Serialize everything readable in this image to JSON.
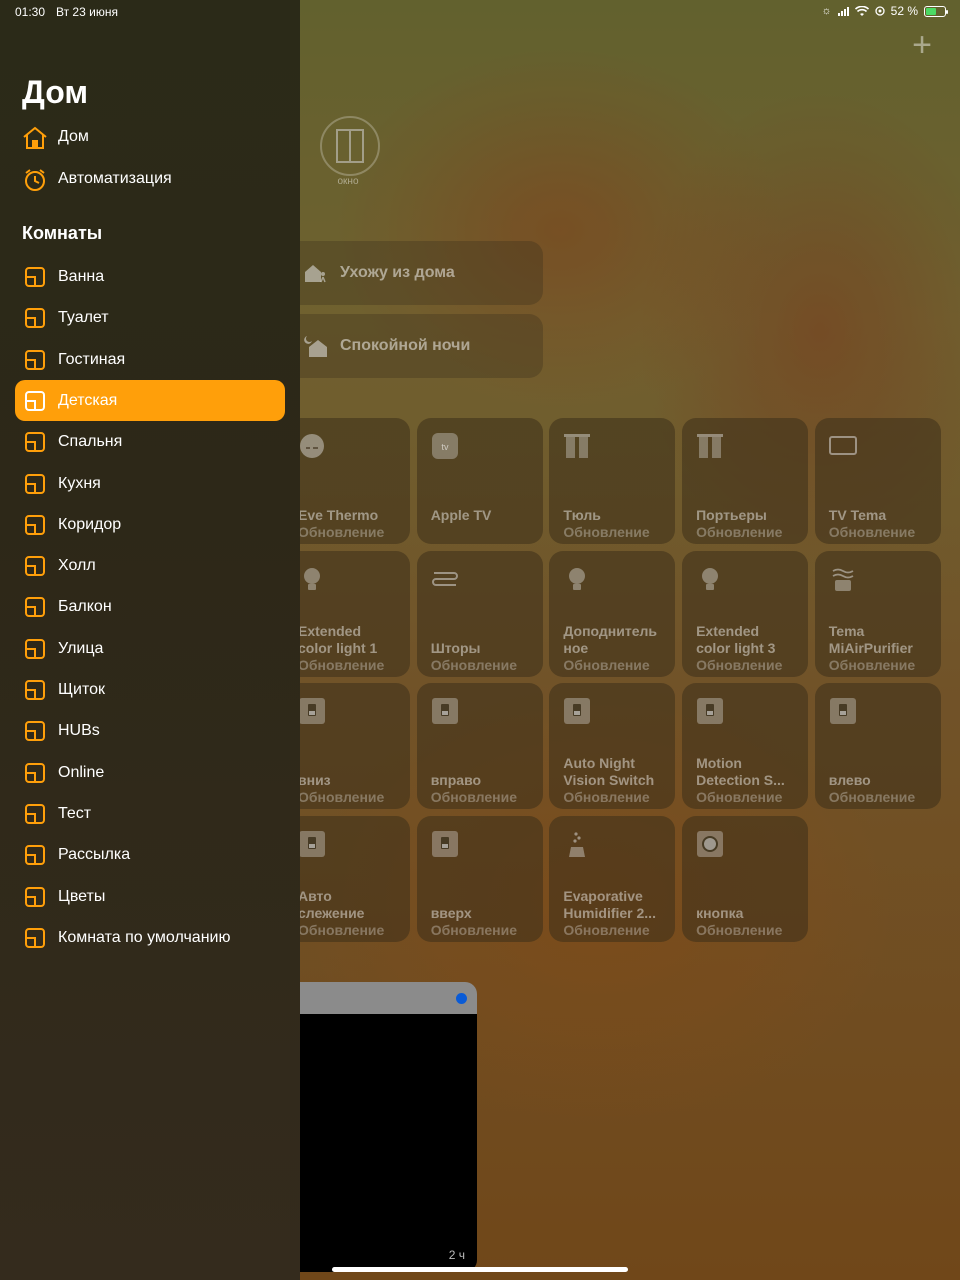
{
  "status_bar": {
    "time": "01:30",
    "date": "Вт 23 июня",
    "battery": "52 %"
  },
  "sidebar": {
    "title": "Дом",
    "nav": [
      {
        "label": "Дом",
        "icon": "house-icon"
      },
      {
        "label": "Автоматизация",
        "icon": "clock-icon"
      }
    ],
    "rooms_header": "Комнаты",
    "rooms": [
      {
        "label": "Ванна",
        "active": false
      },
      {
        "label": "Туалет",
        "active": false
      },
      {
        "label": "Гостиная",
        "active": false
      },
      {
        "label": "Детская",
        "active": true
      },
      {
        "label": "Спальня",
        "active": false
      },
      {
        "label": "Кухня",
        "active": false
      },
      {
        "label": "Коридор",
        "active": false
      },
      {
        "label": "Холл",
        "active": false
      },
      {
        "label": "Балкон",
        "active": false
      },
      {
        "label": "Улица",
        "active": false
      },
      {
        "label": "Щиток",
        "active": false
      },
      {
        "label": "HUBs",
        "active": false
      },
      {
        "label": "Online",
        "active": false
      },
      {
        "label": "Тест",
        "active": false
      },
      {
        "label": "Рассылка",
        "active": false
      },
      {
        "label": "Цветы",
        "active": false
      },
      {
        "label": "Комната по умолчанию",
        "active": false
      }
    ],
    "accent_color": "#ff9f0a"
  },
  "main": {
    "window_accessory": "окно",
    "scenes": [
      {
        "label": "Ухожу из дома",
        "icon": "leave-home-icon"
      },
      {
        "label": "Спокойной ночи",
        "icon": "goodnight-home-icon"
      }
    ],
    "tiles": [
      {
        "name": "Eve Thermo",
        "status": "Обновление",
        "icon": "thermostat-icon"
      },
      {
        "name": "Apple TV",
        "status": "",
        "icon": "apple-tv-icon"
      },
      {
        "name": "Тюль",
        "status": "Обновление",
        "icon": "curtain-icon"
      },
      {
        "name": "Портьеры",
        "status": "Обновление",
        "icon": "curtain-icon"
      },
      {
        "name": "TV Tema",
        "status": "Обновление",
        "icon": "tv-icon"
      },
      {
        "name": "Extended\ncolor light 1",
        "status": "Обновление",
        "icon": "bulb-icon"
      },
      {
        "name": "Шторы",
        "status": "Обновление",
        "icon": "blinds-icon"
      },
      {
        "name": "Доподнитель\nное",
        "status": "Обновление",
        "icon": "bulb-icon"
      },
      {
        "name": "Extended\ncolor light 3",
        "status": "Обновление",
        "icon": "bulb-icon"
      },
      {
        "name": "Tema\nMiAirPurifier",
        "status": "Обновление",
        "icon": "air-purifier-icon"
      },
      {
        "name": "вниз",
        "status": "Обновление",
        "icon": "switch-icon"
      },
      {
        "name": "вправо",
        "status": "Обновление",
        "icon": "switch-icon"
      },
      {
        "name": "Auto Night\nVision Switch",
        "status": "Обновление",
        "icon": "switch-icon"
      },
      {
        "name": "Motion\nDetection S...",
        "status": "Обновление",
        "icon": "switch-icon"
      },
      {
        "name": "влево",
        "status": "Обновление",
        "icon": "switch-icon"
      },
      {
        "name": "Авто\nслежение",
        "status": "Обновление",
        "icon": "switch-icon"
      },
      {
        "name": "вверх",
        "status": "Обновление",
        "icon": "switch-icon"
      },
      {
        "name": "Evaporative\nHumidifier 2...",
        "status": "Обновление",
        "icon": "humidifier-icon"
      },
      {
        "name": "кнопка",
        "status": "Обновление",
        "icon": "button-icon"
      }
    ],
    "camera": {
      "age": "2 ч"
    }
  }
}
